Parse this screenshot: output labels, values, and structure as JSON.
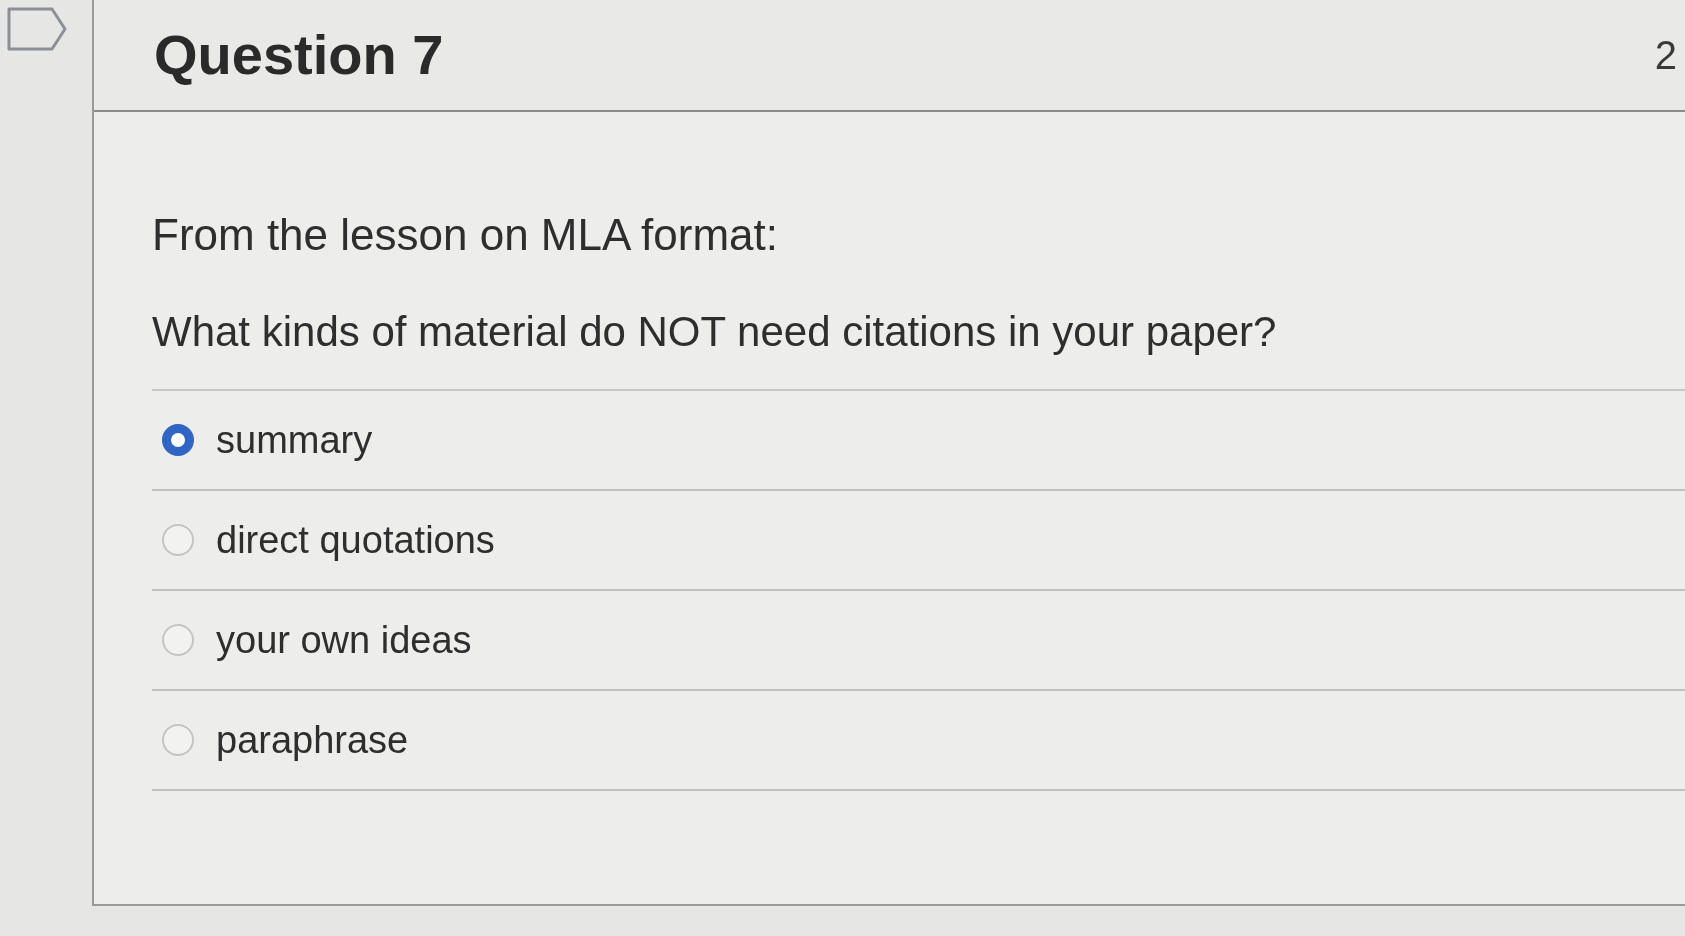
{
  "question": {
    "title": "Question 7",
    "points": "2"
  },
  "prompt": [
    "From the lesson on MLA format:",
    "What kinds of material do NOT need citations in your paper?"
  ],
  "answers": [
    {
      "label": "summary",
      "selected": true
    },
    {
      "label": "direct quotations",
      "selected": false
    },
    {
      "label": "your own ideas",
      "selected": false
    },
    {
      "label": "paraphrase",
      "selected": false
    }
  ]
}
